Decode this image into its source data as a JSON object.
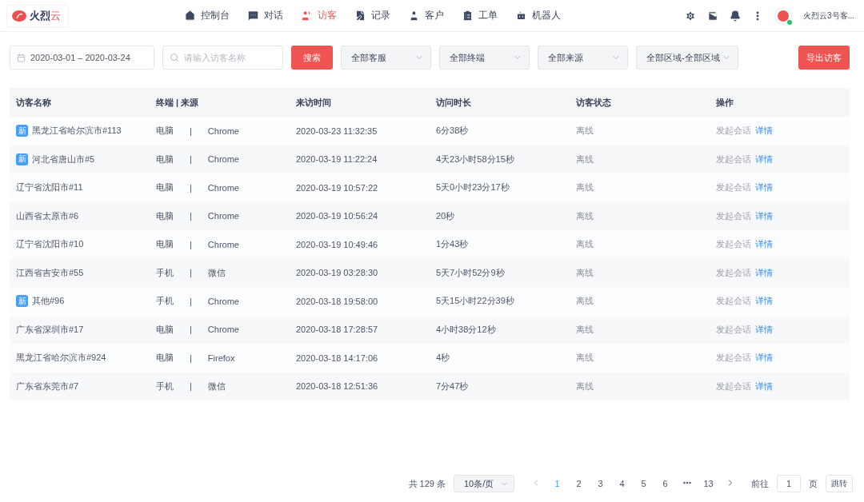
{
  "brand": {
    "name_main": "火烈",
    "name_accent": "云"
  },
  "nav": [
    {
      "kind": "home",
      "label": "控制台",
      "selected": false
    },
    {
      "kind": "chat",
      "label": "对话",
      "selected": false
    },
    {
      "kind": "visitors",
      "label": "访客",
      "selected": true
    },
    {
      "kind": "record",
      "label": "记录",
      "selected": false
    },
    {
      "kind": "customer",
      "label": "客户",
      "selected": false
    },
    {
      "kind": "ticket",
      "label": "工单",
      "selected": false
    },
    {
      "kind": "robot",
      "label": "机器人",
      "selected": false
    }
  ],
  "user": {
    "name": "火烈云3号客...",
    "online": true
  },
  "filters": {
    "date_range": "2020-03-01 – 2020-03-24",
    "search_placeholder": "请输入访客名称",
    "search_button": "搜索",
    "selects": [
      "全部客服",
      "全部终端",
      "全部来源",
      "全部区域-全部区域"
    ],
    "export_button": "导出访客"
  },
  "table": {
    "columns": [
      "访客名称",
      "终端 | 来源",
      "来访时间",
      "访问时长",
      "访客状态",
      "操作"
    ],
    "rows": [
      {
        "new": true,
        "new_badge": "新",
        "name": "黑龙江省哈尔滨市#113",
        "terminal": "电脑",
        "divider": "|",
        "source": "Chrome",
        "time": "2020-03-23 11:32:35",
        "duration": "6分38秒",
        "status": "离线",
        "action": "发起会话",
        "link": "详情"
      },
      {
        "new": true,
        "new_badge": "新",
        "name": "河北省唐山市#5",
        "terminal": "电脑",
        "divider": "|",
        "source": "Chrome",
        "time": "2020-03-19 11:22:24",
        "duration": "4天23小时58分15秒",
        "status": "离线",
        "action": "发起会话",
        "link": "详情"
      },
      {
        "new": false,
        "name": "辽宁省沈阳市#11",
        "terminal": "电脑",
        "divider": "|",
        "source": "Chrome",
        "time": "2020-03-19 10:57:22",
        "duration": "5天0小时23分17秒",
        "status": "离线",
        "action": "发起会话",
        "link": "详情"
      },
      {
        "new": false,
        "name": "山西省太原市#6",
        "terminal": "电脑",
        "divider": "|",
        "source": "Chrome",
        "time": "2020-03-19 10:56:24",
        "duration": "20秒",
        "status": "离线",
        "action": "发起会话",
        "link": "详情"
      },
      {
        "new": false,
        "name": "辽宁省沈阳市#10",
        "terminal": "电脑",
        "divider": "|",
        "source": "Chrome",
        "time": "2020-03-19 10:49:46",
        "duration": "1分43秒",
        "status": "离线",
        "action": "发起会话",
        "link": "详情"
      },
      {
        "new": false,
        "name": "江西省吉安市#55",
        "terminal": "手机",
        "divider": "|",
        "source": "微信",
        "time": "2020-03-19 03:28:30",
        "duration": "5天7小时52分9秒",
        "status": "离线",
        "action": "发起会话",
        "link": "详情"
      },
      {
        "new": true,
        "new_badge": "新",
        "name": "其他#96",
        "terminal": "手机",
        "divider": "|",
        "source": "Chrome",
        "time": "2020-03-18 19:58:00",
        "duration": "5天15小时22分39秒",
        "status": "离线",
        "action": "发起会话",
        "link": "详情"
      },
      {
        "new": false,
        "name": "广东省深圳市#17",
        "terminal": "电脑",
        "divider": "|",
        "source": "Chrome",
        "time": "2020-03-18 17:28:57",
        "duration": "4小时38分12秒",
        "status": "离线",
        "action": "发起会话",
        "link": "详情"
      },
      {
        "new": false,
        "name": "黑龙江省哈尔滨市#924",
        "terminal": "电脑",
        "divider": "|",
        "source": "Firefox",
        "time": "2020-03-18 14:17:06",
        "duration": "4秒",
        "status": "离线",
        "action": "发起会话",
        "link": "详情"
      },
      {
        "new": false,
        "name": "广东省东莞市#7",
        "terminal": "手机",
        "divider": "|",
        "source": "微信",
        "time": "2020-03-18 12:51:36",
        "duration": "7分47秒",
        "status": "离线",
        "action": "发起会话",
        "link": "详情"
      }
    ]
  },
  "pagination": {
    "total": "共 129 条",
    "page_size": "10条/页",
    "pages": [
      {
        "kind": "page",
        "label": "1",
        "selected": true
      },
      {
        "kind": "page",
        "label": "2",
        "selected": false
      },
      {
        "kind": "page",
        "label": "3",
        "selected": false
      },
      {
        "kind": "page",
        "label": "4",
        "selected": false
      },
      {
        "kind": "page",
        "label": "5",
        "selected": false
      },
      {
        "kind": "page",
        "label": "6",
        "selected": false
      },
      {
        "kind": "more"
      },
      {
        "kind": "page",
        "label": "13",
        "selected": false
      }
    ],
    "goto_label": "前往",
    "goto_value": "1",
    "goto_unit": "页",
    "goto_button": "跳转"
  }
}
